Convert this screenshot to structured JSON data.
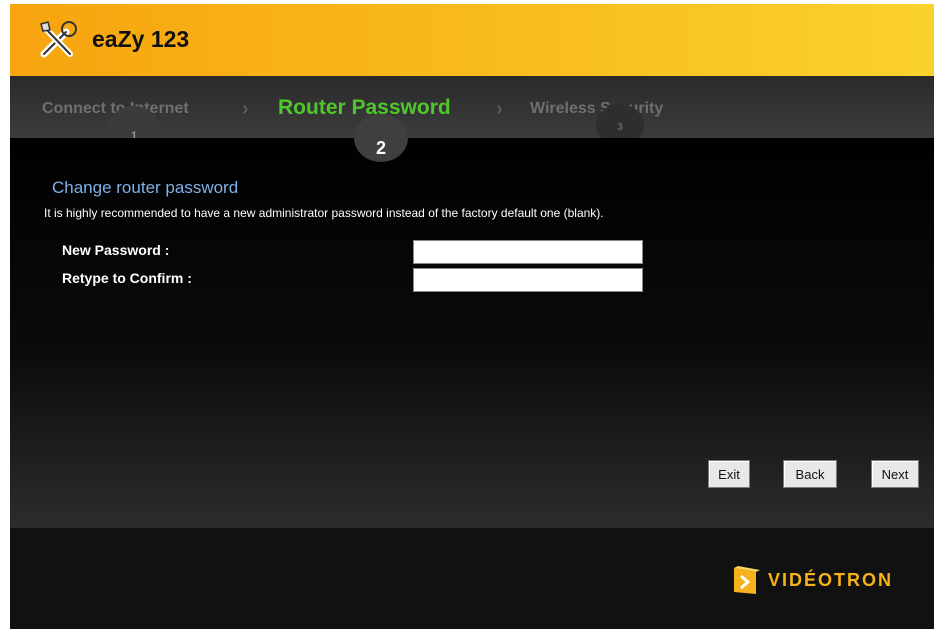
{
  "header": {
    "title": "eaZy 123",
    "icon": "tools-icon",
    "accent": "#f8b81a"
  },
  "steps": [
    {
      "label": "Connect to Internet",
      "number": "1",
      "state": "done",
      "color": "#6f6f6f"
    },
    {
      "label": "Router Password",
      "number": "2",
      "state": "current",
      "color": "#4fc72c"
    },
    {
      "label": "Wireless Security",
      "number": "3",
      "state": "upcoming",
      "color": "#6f6f6f"
    }
  ],
  "section": {
    "title": "Change router password",
    "description": "It is highly recommended to have a new administrator password instead of the factory default one (blank)."
  },
  "form": {
    "new_password_label": "New Password :",
    "new_password_value": "",
    "confirm_label": "Retype to Confirm :",
    "confirm_value": ""
  },
  "buttons": {
    "exit": "Exit",
    "back": "Back",
    "next": "Next"
  },
  "footer": {
    "brand": "VIDÉOTRON",
    "brand_color": "#f6b21b"
  }
}
